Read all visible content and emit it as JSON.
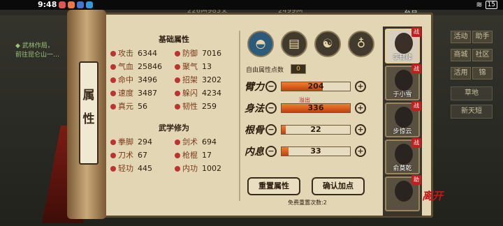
{
  "status_bar": {
    "time": "9:48",
    "battery": "15"
  },
  "top_bar": {
    "resource1": "240",
    "resource2": "226两983文",
    "resource3": "2499两",
    "announcement": "公告"
  },
  "left_quest": {
    "title": "◆ 武林作局，",
    "desc": "前往昆仑山一…"
  },
  "right_menu": {
    "row1": [
      "活动",
      "助手"
    ],
    "row2": [
      "商城",
      "社区"
    ],
    "row3": [
      "活用",
      "锦"
    ],
    "map": "草地",
    "weather": "新天短"
  },
  "title_vertical": "属性",
  "basic": {
    "title": "基础属性",
    "attrs": [
      {
        "name": "攻击",
        "value": "6344"
      },
      {
        "name": "防御",
        "value": "7016"
      },
      {
        "name": "气血",
        "value": "25846"
      },
      {
        "name": "聚气",
        "value": "13"
      },
      {
        "name": "命中",
        "value": "3496"
      },
      {
        "name": "招架",
        "value": "3202"
      },
      {
        "name": "速度",
        "value": "3487"
      },
      {
        "name": "躲闪",
        "value": "4234"
      },
      {
        "name": "真元",
        "value": "56"
      },
      {
        "name": "韧性",
        "value": "259"
      }
    ]
  },
  "martial": {
    "title": "武学修为",
    "attrs": [
      {
        "name": "拳脚",
        "value": "294"
      },
      {
        "name": "剑术",
        "value": "694"
      },
      {
        "name": "刀术",
        "value": "67"
      },
      {
        "name": "枪棍",
        "value": "17"
      },
      {
        "name": "轻功",
        "value": "445"
      },
      {
        "name": "内功",
        "value": "1002"
      }
    ]
  },
  "free_points": {
    "label": "自由属性点数",
    "value": "0"
  },
  "points": [
    {
      "label": "臂力",
      "value": "204",
      "fill": 0.6
    },
    {
      "label": "身法",
      "value": "336",
      "fill": 1.0,
      "overflow": "溢出"
    },
    {
      "label": "根骨",
      "value": "22",
      "fill": 0.06
    },
    {
      "label": "内息",
      "value": "33",
      "fill": 0.1
    }
  ],
  "buttons": {
    "reset": "重置属性",
    "confirm": "确认加点",
    "free_reset": "免费重置次数:2"
  },
  "characters": [
    {
      "name": "李郁臻",
      "tag": "战",
      "selected": true
    },
    {
      "name": "于小雪",
      "tag": "战"
    },
    {
      "name": "步惊云",
      "tag": "战"
    },
    {
      "name": "俞莫乾",
      "tag": "战"
    },
    {
      "name": "",
      "tag": "助"
    }
  ],
  "close_label": "离开"
}
